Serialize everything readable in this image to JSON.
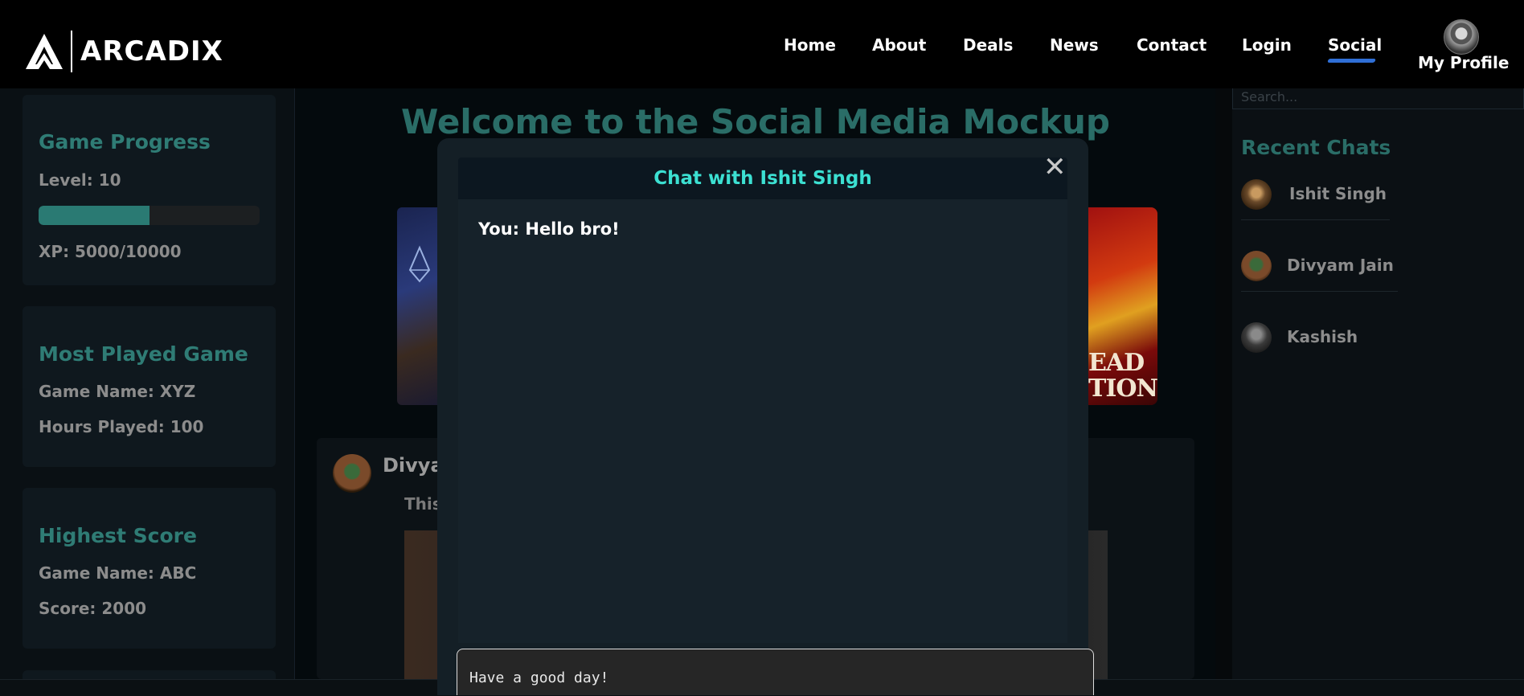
{
  "header": {
    "logo_text": "ARCADIX",
    "nav": [
      {
        "label": "Home"
      },
      {
        "label": "About"
      },
      {
        "label": "Deals"
      },
      {
        "label": "News"
      },
      {
        "label": "Contact"
      },
      {
        "label": "Login"
      },
      {
        "label": "Social",
        "active": true
      }
    ],
    "profile_label": "My Profile"
  },
  "left_sidebar": {
    "progress": {
      "title": "Game Progress",
      "level_text": "Level: 10",
      "xp_text": "XP: 5000/10000",
      "xp_fraction": 0.5
    },
    "most_played": {
      "title": "Most Played Game",
      "game_name_text": "Game Name: XYZ",
      "hours_text": "Hours Played: 100"
    },
    "highest_score": {
      "title": "Highest Score",
      "game_name_text": "Game Name: ABC",
      "score_text": "Score: 2000"
    }
  },
  "main": {
    "welcome": "Welcome to the Social Media Mockup",
    "post": {
      "author": "Divya",
      "text": "This"
    }
  },
  "right_sidebar": {
    "search_placeholder": "Search...",
    "recent_title": "Recent Chats",
    "chats": [
      {
        "name": "Ishit Singh"
      },
      {
        "name": "Divyam Jain"
      },
      {
        "name": "Kashish"
      }
    ]
  },
  "chat_modal": {
    "title": "Chat with Ishit Singh",
    "close_symbol": "✕",
    "messages": [
      {
        "text": "You: Hello bro!"
      }
    ],
    "input_value": "Have a good day!"
  },
  "colors": {
    "accent_teal": "#2a6d67",
    "modal_title": "#3ce0d2",
    "nav_underline": "#2f6fd6",
    "game_cover_right": "#c21a10"
  }
}
